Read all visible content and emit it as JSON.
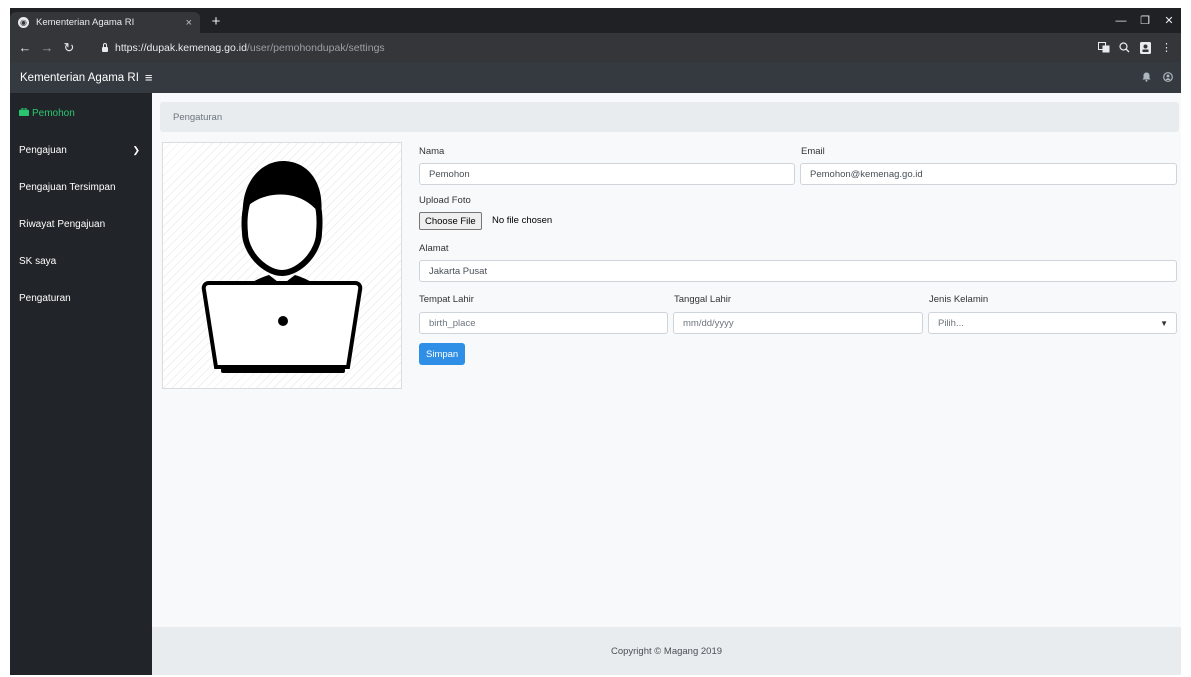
{
  "browser": {
    "tab_title": "Kementerian Agama RI",
    "tab_close": "×",
    "new_tab": "+",
    "url_scheme": "https://",
    "url_host": "dupak.kemenag.go.id",
    "url_path": "/user/pemohondupak/settings",
    "window_min": "—",
    "window_max": "❐",
    "window_close": "✕"
  },
  "app": {
    "brand": "Kementerian Agama RI",
    "menu_glyph": "≡"
  },
  "sidebar": {
    "items": [
      {
        "label": "Pemohon"
      },
      {
        "label": "Pengajuan"
      },
      {
        "label": "Pengajuan Tersimpan"
      },
      {
        "label": "Riwayat Pengajuan"
      },
      {
        "label": "SK saya"
      },
      {
        "label": "Pengaturan"
      }
    ]
  },
  "breadcrumb": "Pengaturan",
  "form": {
    "nama_label": "Nama",
    "nama_value": "Pemohon",
    "email_label": "Email",
    "email_value": "Pemohon@kemenag.go.id",
    "upload_label": "Upload Foto",
    "choose_file": "Choose File",
    "no_file": "No file chosen",
    "alamat_label": "Alamat",
    "alamat_value": "Jakarta Pusat",
    "tempat_label": "Tempat Lahir",
    "tempat_placeholder": "birth_place",
    "tanggal_label": "Tanggal Lahir",
    "tanggal_placeholder": "mm/dd/yyyy",
    "gender_label": "Jenis Kelamin",
    "gender_selected": "Pilih...",
    "save_label": "Simpan"
  },
  "footer": "Copyright © Magang 2019",
  "colors": {
    "accent": "#2f8fe6",
    "active_menu": "#28c76f",
    "sidebar_bg": "#212529",
    "topbar_bg": "#343a40"
  }
}
